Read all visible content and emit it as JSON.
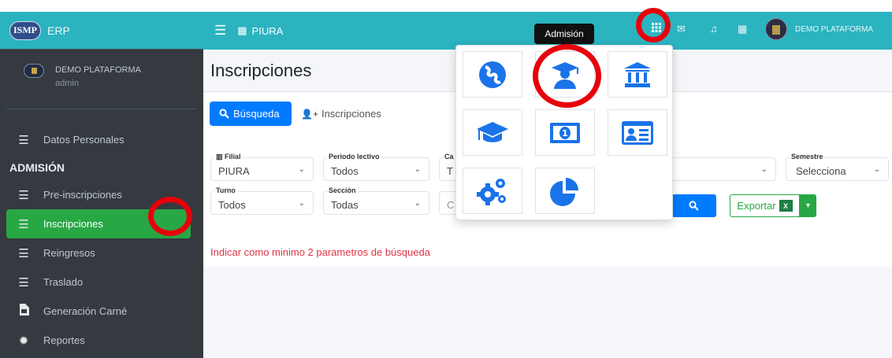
{
  "brand": {
    "logo": "ISMP",
    "name": "ERP"
  },
  "sidebar": {
    "user_name": "DEMO PLATAFORMA",
    "user_role": "admin",
    "items": [
      {
        "label": "Datos Personales",
        "icon": "list-icon"
      },
      {
        "label": "Pre-inscripciones",
        "icon": "list-icon"
      },
      {
        "label": "Inscripciones",
        "icon": "list-icon",
        "active": true
      },
      {
        "label": "Reingresos",
        "icon": "list-icon"
      },
      {
        "label": "Traslado",
        "icon": "list-icon"
      },
      {
        "label": "Generación Carné",
        "icon": "file-icon"
      },
      {
        "label": "Reportes",
        "icon": "gear-icon"
      }
    ],
    "section_header": "ADMISIÓN"
  },
  "topbar": {
    "branch": "PIURA",
    "user_name": "DEMO PLATAFORMA",
    "icons": [
      "apps-grid-icon",
      "mail-icon",
      "bell-icon",
      "calendar-icon"
    ]
  },
  "page": {
    "title": "Inscripciones",
    "tabs": {
      "search": "Búsqueda",
      "enroll": "Inscripciones"
    },
    "filters": {
      "filial": {
        "legend": "Filial",
        "value": "PIURA"
      },
      "periodo": {
        "legend": "Periodo lectivo",
        "value": "Todos"
      },
      "carrera_legend_partial": "Ca",
      "carrera_value_partial": "T",
      "semestre": {
        "legend": "Semestre",
        "value": "Selecciona"
      },
      "turno": {
        "legend": "Turno",
        "value": "Todos"
      },
      "seccion": {
        "legend": "Sección",
        "value": "Todas"
      },
      "code_partial": "C"
    },
    "export_label": "Exportar",
    "warning": "Indicar como minimo 2 parametros de búsqueda"
  },
  "apps_menu": {
    "tooltip": "Admisión",
    "tiles": [
      "globe-icon",
      "graduate-user-icon",
      "institution-icon",
      "graduation-cap-icon",
      "money-icon",
      "id-card-icon",
      "cogs-icon",
      "pie-chart-icon"
    ]
  },
  "colors": {
    "teal": "#2bb3c0",
    "sidebar": "#343a40",
    "primary": "#007bff",
    "success": "#28a745",
    "danger": "#dc3545",
    "icon_blue": "#1a73e8",
    "annotation": "#e8000b"
  }
}
